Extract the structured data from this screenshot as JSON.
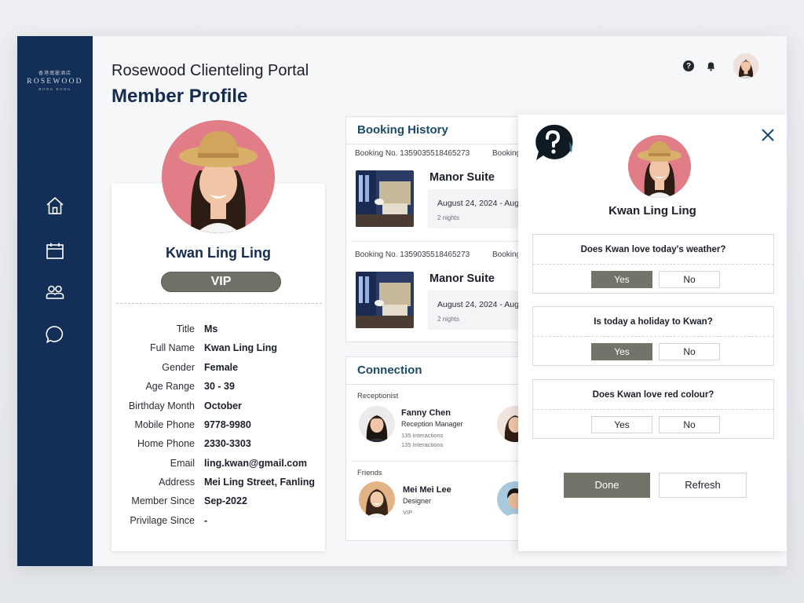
{
  "brand": {
    "chinese": "香港瑰麗酒店",
    "name": "ROSEWOOD",
    "location": "HONG KONG"
  },
  "sidebar": {
    "items": [
      {
        "icon": "home-icon"
      },
      {
        "icon": "calendar-icon"
      },
      {
        "icon": "users-icon"
      },
      {
        "icon": "chat-icon"
      }
    ]
  },
  "header": {
    "portal_title": "Rosewood Clienteling Portal",
    "page_title": "Member Profile",
    "icons": [
      "help-icon",
      "bell-icon",
      "user-avatar"
    ]
  },
  "profile": {
    "name": "Kwan Ling Ling",
    "tier": "VIP",
    "fields": [
      {
        "label": "Title",
        "value": "Ms"
      },
      {
        "label": "Full Name",
        "value": "Kwan Ling Ling"
      },
      {
        "label": "Gender",
        "value": "Female"
      },
      {
        "label": "Age Range",
        "value": "30 - 39"
      },
      {
        "label": "Birthday Month",
        "value": "October"
      },
      {
        "label": "Mobile Phone",
        "value": "9778-9980"
      },
      {
        "label": "Home Phone",
        "value": "2330-3303"
      },
      {
        "label": "Email",
        "value": "ling.kwan@gmail.com"
      },
      {
        "label": "Address",
        "value": "Mei Ling Street, Fanling"
      },
      {
        "label": "Member Since",
        "value": "Sep-2022"
      },
      {
        "label": "Privilage Since",
        "value": "-"
      }
    ]
  },
  "booking_history": {
    "title": "Booking History",
    "bookings": [
      {
        "booking_no": "Booking No.  1359035518465273",
        "booking_no_cut": "Booking",
        "room": "Manor Suite",
        "date": "August 24, 2024 - Augu",
        "nights": "2 nights"
      },
      {
        "booking_no": "Booking No.  1359035518465273",
        "booking_no_cut": "Booking",
        "room": "Manor Suite",
        "date": "August 24, 2024 - Augu",
        "nights": "2 nights"
      }
    ]
  },
  "connection": {
    "title": "Connection",
    "receptionist_label": "Receptionist",
    "receptionist": {
      "name": "Fanny Chen",
      "role": "Reception Manager",
      "meta1": "135 Interactions",
      "meta2": "135 Interactions"
    },
    "friends_label": "Friends",
    "friend": {
      "name": "Mei Mei Lee",
      "role": "Designer",
      "meta": "VIP"
    }
  },
  "survey": {
    "name": "Kwan Ling Ling",
    "questions": [
      {
        "text": "Does Kwan love today's weather?",
        "yes": "Yes",
        "no": "No",
        "selected": "yes"
      },
      {
        "text": "Is today a holiday to Kwan?",
        "yes": "Yes",
        "no": "No",
        "selected": "yes"
      },
      {
        "text": "Does Kwan love red colour?",
        "yes": "Yes",
        "no": "No",
        "selected": "none"
      }
    ],
    "done_label": "Done",
    "refresh_label": "Refresh"
  },
  "colors": {
    "navy": "#142f57",
    "accent_teal": "#1d4b66",
    "selected_grey": "#737369",
    "avatar_pink": "#e07d86"
  }
}
